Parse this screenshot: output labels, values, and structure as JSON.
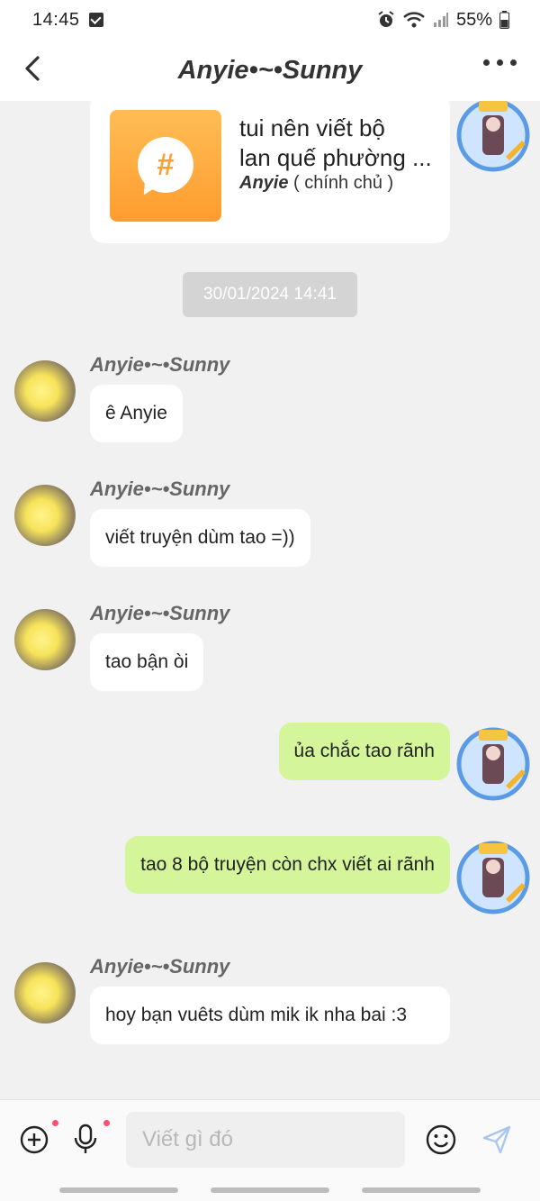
{
  "status_bar": {
    "time": "14:45",
    "battery": "55%"
  },
  "header": {
    "title": "Anyie•~•Sunny"
  },
  "card": {
    "title_line1": "tui nên viết bộ",
    "title_line2": "lan quế phường ...",
    "author": "Anyie",
    "author_suffix": " ( chính chủ )",
    "icon": "hashtag-icon"
  },
  "timestamp": "30/01/2024 14:41",
  "messages": [
    {
      "sender": "Anyie•~•Sunny",
      "text": "ê Anyie",
      "side": "left"
    },
    {
      "sender": "Anyie•~•Sunny",
      "text": "viết truyện dùm tao =))",
      "side": "left"
    },
    {
      "sender": "Anyie•~•Sunny",
      "text": "tao bận òi",
      "side": "left"
    },
    {
      "sender": "",
      "text": "ủa chắc tao rãnh",
      "side": "right"
    },
    {
      "sender": "",
      "text": "tao 8 bộ truyện còn chx viết ai rãnh",
      "side": "right"
    },
    {
      "sender": "Anyie•~•Sunny",
      "text": "hoy bạn vuêts dùm mik ik nha bai :3",
      "side": "left"
    }
  ],
  "composer": {
    "placeholder": "Viết gì đó"
  },
  "colors": {
    "my_bubble": "#d4f59a",
    "other_bubble": "#ffffff",
    "accent": "#ff9f33",
    "send": "#a9c6ee"
  }
}
